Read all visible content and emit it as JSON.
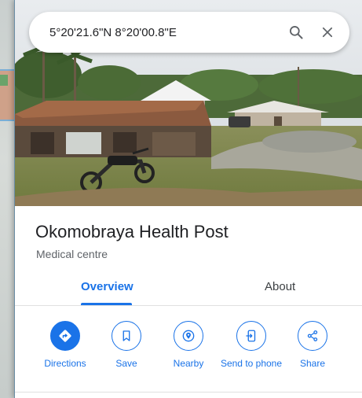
{
  "search": {
    "value": "5°20'21.6\"N 8°20'00.8\"E"
  },
  "place": {
    "name": "Okomobraya Health Post",
    "category": "Medical centre"
  },
  "tabs": [
    {
      "label": "Overview",
      "active": true
    },
    {
      "label": "About",
      "active": false
    }
  ],
  "actions": [
    {
      "label": "Directions",
      "icon": "directions-icon"
    },
    {
      "label": "Save",
      "icon": "bookmark-icon"
    },
    {
      "label": "Nearby",
      "icon": "nearby-icon"
    },
    {
      "label": "Send to phone",
      "icon": "send-to-phone-icon"
    },
    {
      "label": "Share",
      "icon": "share-icon"
    }
  ],
  "colors": {
    "accent": "#1a73e8",
    "title": "#202124",
    "secondary": "#5f6368"
  }
}
